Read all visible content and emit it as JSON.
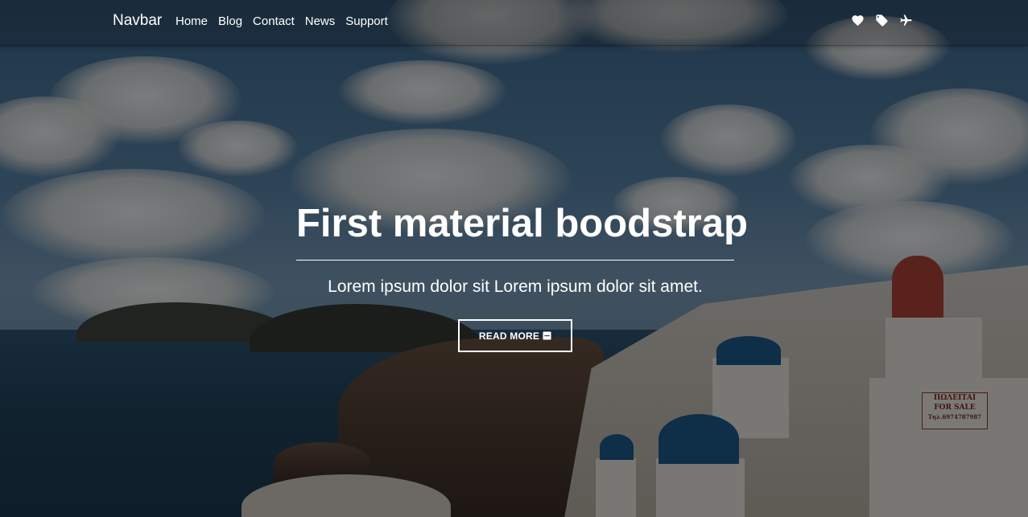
{
  "navbar": {
    "brand": "Navbar",
    "links": [
      "Home",
      "Blog",
      "Contact",
      "News",
      "Support"
    ],
    "icons": [
      "heart-icon",
      "tag-icon",
      "plane-icon"
    ]
  },
  "hero": {
    "title": "First material boodstrap",
    "subtitle": "Lorem ipsum dolor sit Lorem ipsum dolor sit amet.",
    "button_label": "READ MORE",
    "button_icon": "book-icon"
  },
  "background": {
    "sign_line1": "ΠΩΛΕΙΤΑΙ",
    "sign_line2": "FOR SALE",
    "sign_line3": "Τηλ.6974787987"
  },
  "colors": {
    "overlay": "rgba(0,0,0,0.5)",
    "text": "#ffffff",
    "dome_blue": "#1f5d8f"
  }
}
